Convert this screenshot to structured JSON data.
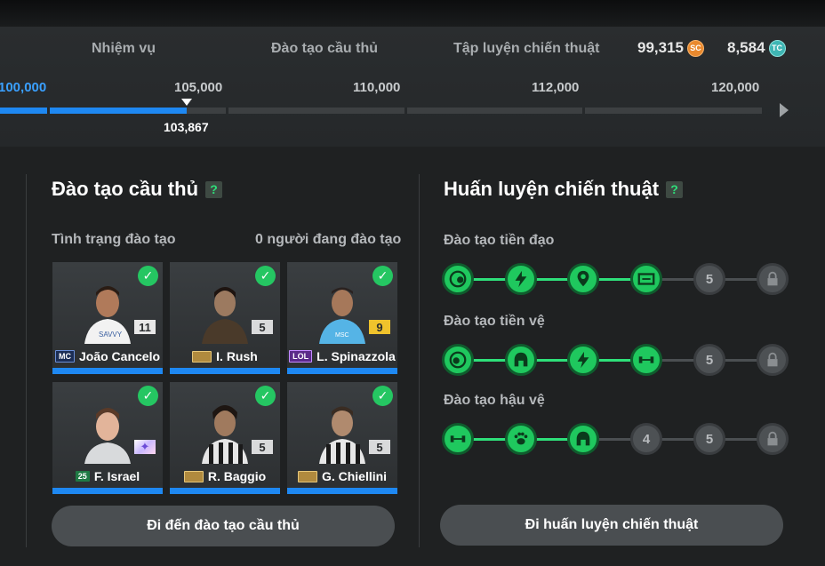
{
  "tabs": [
    "Nhiệm vụ",
    "Đào tạo cầu thủ",
    "Tập luyện chiến thuật"
  ],
  "currency": {
    "sc": {
      "value": "99,315",
      "icon": "SC"
    },
    "tc": {
      "value": "8,584",
      "icon": "TC"
    }
  },
  "progress": {
    "milestones": [
      "100,000",
      "105,000",
      "110,000",
      "112,000",
      "120,000"
    ],
    "current": "103,867"
  },
  "player_training": {
    "title": "Đào tạo cầu thủ",
    "help": "?",
    "status_label": "Tình trạng đào tạo",
    "status_value": "0 người đang đào tạo",
    "players": [
      {
        "name": "João Cancelo",
        "season": "MC",
        "level": "11"
      },
      {
        "name": "I. Rush",
        "season": "",
        "level": "5"
      },
      {
        "name": "L. Spinazzola",
        "season": "LOL",
        "level": "9"
      },
      {
        "name": "F. Israel",
        "season": "25",
        "level": ""
      },
      {
        "name": "R. Baggio",
        "season": "",
        "level": "5"
      },
      {
        "name": "G. Chiellini",
        "season": "",
        "level": "5"
      }
    ],
    "button": "Đi đến đào tạo cầu thủ"
  },
  "tactical": {
    "title": "Huấn luyện chiến thuật",
    "help": "?",
    "rows": [
      {
        "label": "Đào tạo tiền đạo",
        "locked_num": "5"
      },
      {
        "label": "Đào tạo tiền vệ",
        "locked_num": "5"
      },
      {
        "label": "Đào tạo hậu vệ",
        "num4": "4",
        "locked_num": "5"
      }
    ],
    "button": "Đi huấn luyện chiến thuật"
  }
}
